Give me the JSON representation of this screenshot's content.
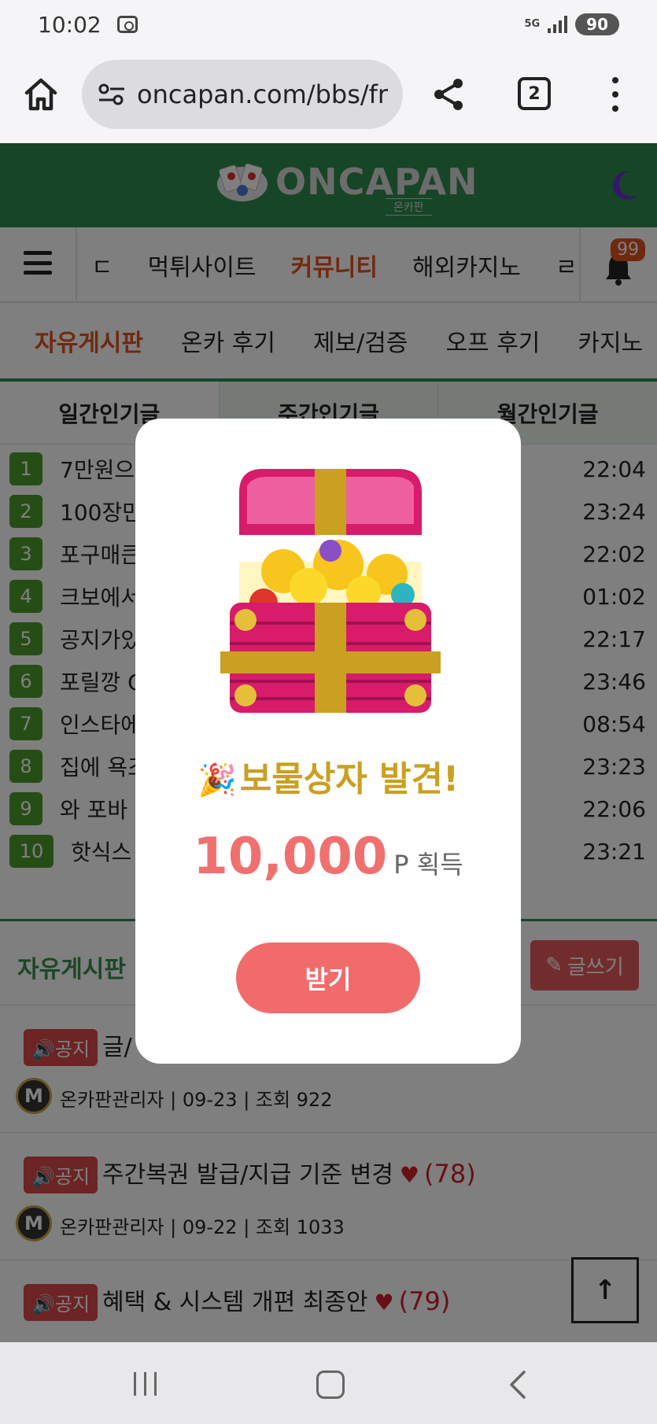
{
  "status": {
    "time": "10:02",
    "network": "5G",
    "battery": "90"
  },
  "browser": {
    "url": "oncapan.com/bbs/fr",
    "tab_count": "2"
  },
  "header": {
    "logo_text": "ONCAPAN",
    "logo_sub": "온카판"
  },
  "nav": {
    "items": [
      "ㄷ",
      "먹튀사이트",
      "커뮤니티",
      "해외카지노",
      "ㄹ"
    ],
    "active_index": 2,
    "bell_count": "99"
  },
  "subnav": {
    "items": [
      "자유게시판",
      "온카 후기",
      "제보/검증",
      "오프 후기",
      "카지노"
    ]
  },
  "ranking": {
    "tabs": [
      "일간인기글",
      "주간인기글",
      "월간인기글"
    ],
    "rows": [
      {
        "num": "1",
        "title": "7만원으",
        "time": "22:04"
      },
      {
        "num": "2",
        "title": "100장만",
        "time": "23:24"
      },
      {
        "num": "3",
        "title": "포구매큰",
        "time": "22:02"
      },
      {
        "num": "4",
        "title": "크보에서",
        "time": "01:02"
      },
      {
        "num": "5",
        "title": "공지가있",
        "time": "22:17"
      },
      {
        "num": "6",
        "title": "포릴깡 C",
        "time": "23:46"
      },
      {
        "num": "7",
        "title": "인스타에",
        "time": "08:54"
      },
      {
        "num": "8",
        "title": "집에 욕조",
        "time": "23:23"
      },
      {
        "num": "9",
        "title": "와 포바",
        "time": "22:06"
      },
      {
        "num": "10",
        "title": "핫식스",
        "time": "23:21"
      }
    ]
  },
  "board": {
    "title": "자유게시판",
    "write_label": "글쓰기",
    "posts": [
      {
        "badge": "공지",
        "title": "글/",
        "heart": "",
        "count": "",
        "avatar": "M",
        "meta": "온카판관리자 | 09-23 | 조회 922"
      },
      {
        "badge": "공지",
        "title": "주간복권 발급/지급 기준 변경",
        "heart": "♥",
        "count": "(78)",
        "avatar": "M",
        "meta": "온카판관리자 | 09-22 | 조회 1033"
      },
      {
        "badge": "공지",
        "title": "혜택 & 시스템 개편 최종안",
        "heart": "♥",
        "count": "(79)",
        "avatar": "",
        "meta": ""
      }
    ]
  },
  "modal": {
    "party_icon": "🎉",
    "title": "보물상자 발견!",
    "amount": "10,000",
    "unit": "P 획득",
    "button": "받기"
  },
  "colors": {
    "brand_green": "#2e8b4e",
    "accent_orange": "#e0531f",
    "modal_button": "#f26b6b",
    "title_gold": "#caa021"
  }
}
